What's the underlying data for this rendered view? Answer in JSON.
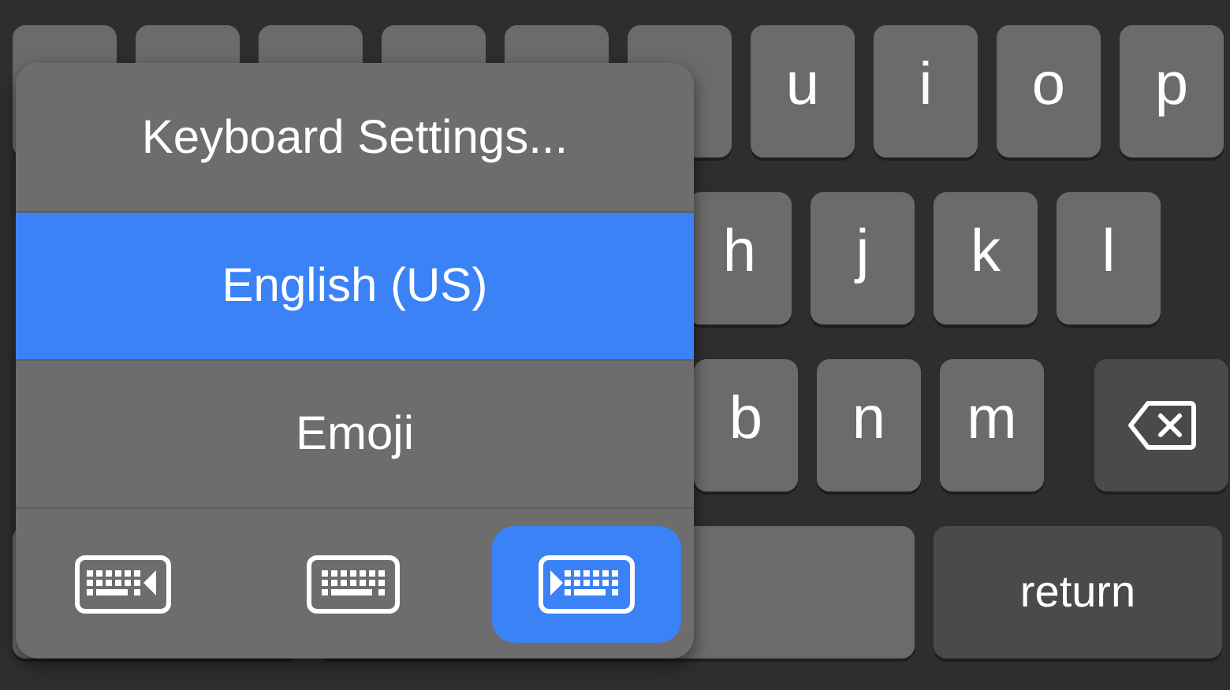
{
  "keyboard": {
    "rows": [
      {
        "keys": [
          {
            "kind": "letter",
            "label": "u"
          },
          {
            "kind": "letter",
            "label": "i"
          },
          {
            "kind": "letter",
            "label": "o"
          },
          {
            "kind": "letter",
            "label": "p"
          }
        ]
      },
      {
        "keys": [
          {
            "kind": "letter",
            "label": "h"
          },
          {
            "kind": "letter",
            "label": "j"
          },
          {
            "kind": "letter",
            "label": "k"
          },
          {
            "kind": "letter",
            "label": "l"
          }
        ]
      },
      {
        "keys": [
          {
            "kind": "letter",
            "label": "b"
          },
          {
            "kind": "letter",
            "label": "n"
          },
          {
            "kind": "letter",
            "label": "m"
          },
          {
            "kind": "delete"
          }
        ]
      },
      {
        "keys": [
          {
            "kind": "space"
          },
          {
            "kind": "return",
            "label": "return"
          }
        ]
      }
    ]
  },
  "popup_menu": {
    "items": [
      {
        "label": "Keyboard Settings...",
        "selected": false
      },
      {
        "label": "English (US)",
        "selected": true
      },
      {
        "label": "Emoji",
        "selected": false
      }
    ],
    "layout_modes": [
      {
        "kind": "left",
        "selected": false
      },
      {
        "kind": "full",
        "selected": false
      },
      {
        "kind": "right",
        "selected": true
      }
    ]
  }
}
